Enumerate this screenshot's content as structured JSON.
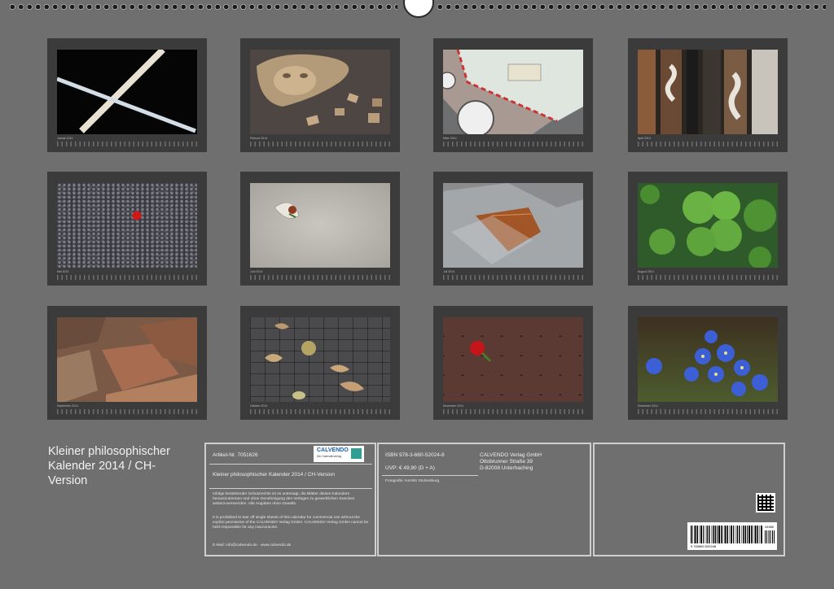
{
  "months": [
    {
      "caption": "Januar 2014",
      "scene": "crossed-sticks"
    },
    {
      "caption": "Februar 2014",
      "scene": "puzzle-face"
    },
    {
      "caption": "März 2014",
      "scene": "airmail-clock"
    },
    {
      "caption": "April 2014",
      "scene": "peeling-wood"
    },
    {
      "caption": "Mai 2014",
      "scene": "gravel-red-stone"
    },
    {
      "caption": "Juni 2014",
      "scene": "leaf-on-concrete"
    },
    {
      "caption": "Juli 2014",
      "scene": "autumn-leaf-foil"
    },
    {
      "caption": "August 2014",
      "scene": "clover"
    },
    {
      "caption": "September 2014",
      "scene": "bricks"
    },
    {
      "caption": "Oktober 2014",
      "scene": "cobblestones-leaves"
    },
    {
      "caption": "November 2014",
      "scene": "rose-paving"
    },
    {
      "caption": "Dezember 2014",
      "scene": "blue-flowers"
    }
  ],
  "title": "Kleiner philosophischer Kalender 2014 / CH-Version",
  "panel1": {
    "article": "Artikel-Nr. 7051626",
    "logo": "CALVENDO",
    "logo_sub": "Der Kalenderverlag",
    "name": "Kleiner philosophischer Kalender 2014 / CH-Version",
    "legal_de": "Infolge bestehender Schutzrechte ist es untersagt, die Blätter dieses Kalenders herauszutrennen und ohne Genehmigung des Verlages zu gewerblichen Zwecken weiterzuverwenden. Alle Angaben ohne Gewähr.",
    "legal_en": "It is prohibited to tear off single sheets of this calendar for commercial use without the explicit permission of the CALVENDO Verlag GmbH. CALVENDO Verlag GmbH cannot be held responsible for any inaccuracies.",
    "email": "E-Mail: info@calvendo.de · www.calvendo.de"
  },
  "panel2": {
    "isbn": "ISBN 978-3-660-52024-8",
    "price": "UVP: € 49,90 (D + A)",
    "photographer": "Fotografin: Kerstin Stolzenburg",
    "publisher_name": "CALVENDO Verlag GmbH",
    "publisher_street": "Ottobrunner Straße 39",
    "publisher_city": "D-82008 Unterhaching"
  },
  "panel3": {
    "barcode_number": "9 783660 520248",
    "barcode_addon": "04980"
  }
}
